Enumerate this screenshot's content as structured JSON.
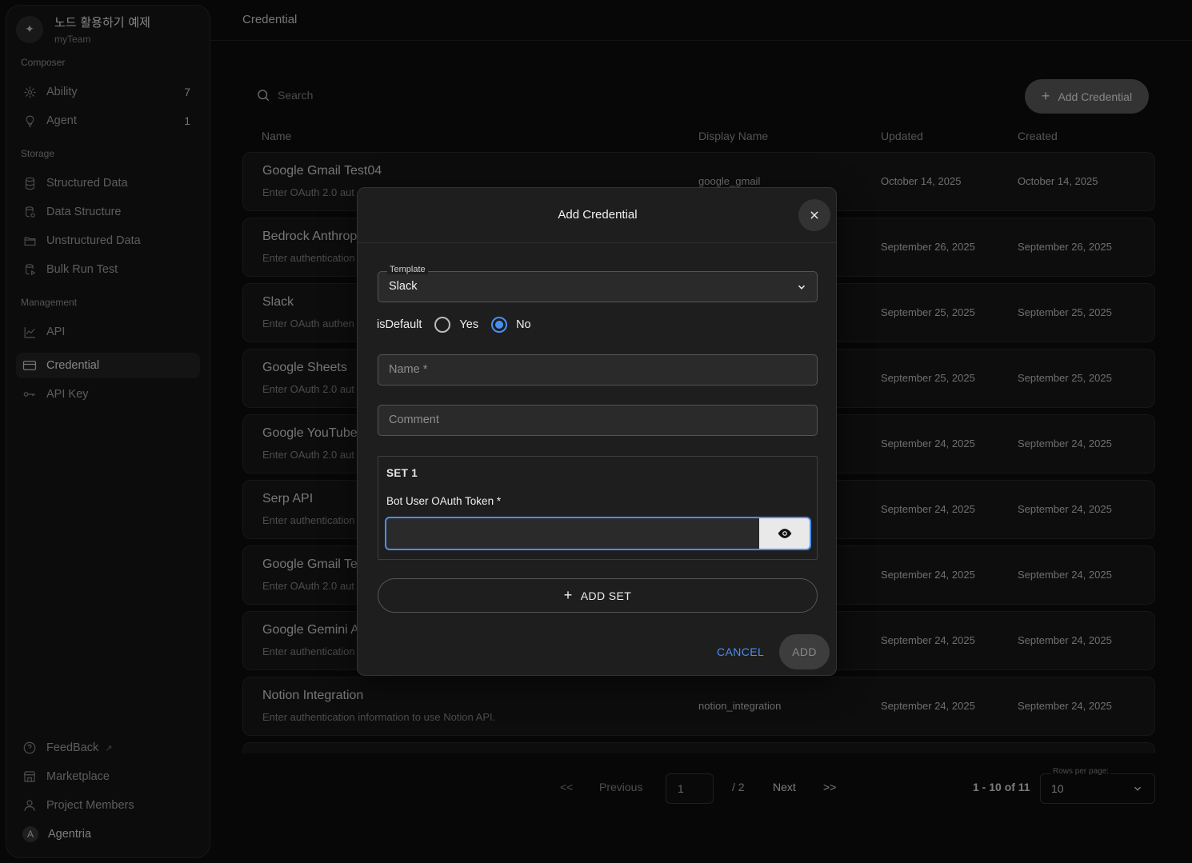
{
  "workspace": {
    "name": "노드 활용하기 예제",
    "team": "myTeam"
  },
  "sidebar": {
    "composer_label": "Composer",
    "storage_label": "Storage",
    "management_label": "Management",
    "items": [
      {
        "label": "Ability",
        "count": "7",
        "icon": "ability-icon"
      },
      {
        "label": "Agent",
        "count": "1",
        "icon": "agent-icon"
      },
      {
        "label": "Structured Data",
        "icon": "database-icon"
      },
      {
        "label": "Data Structure",
        "icon": "data-structure-icon"
      },
      {
        "label": "Unstructured Data",
        "icon": "folder-icon"
      },
      {
        "label": "Bulk Run Test",
        "icon": "bulk-run-icon"
      },
      {
        "label": "API",
        "icon": "chart-line-icon"
      },
      {
        "label": "Credential",
        "icon": "credential-card-icon",
        "active": true
      },
      {
        "label": "API Key",
        "icon": "key-icon"
      }
    ],
    "bottom": [
      {
        "label": "FeedBack",
        "icon": "help-circle-icon"
      },
      {
        "label": "Marketplace",
        "icon": "marketplace-icon"
      },
      {
        "label": "Project Members",
        "icon": "person-icon"
      },
      {
        "label": "Agentria",
        "avatar": "A"
      }
    ]
  },
  "header": {
    "title": "Credential"
  },
  "search": {
    "placeholder": "Search"
  },
  "add_credential_button": "Add Credential",
  "table": {
    "columns": [
      "Name",
      "Display Name",
      "Updated",
      "Created"
    ],
    "rows": [
      {
        "name": "Google Gmail Test04",
        "desc": "Enter OAuth 2.0 aut",
        "display": "google_gmail",
        "updated": "October 14, 2025",
        "created": "October 14, 2025"
      },
      {
        "name": "Bedrock Anthrop",
        "desc": "Enter authentication",
        "display": "",
        "updated": "September 26, 2025",
        "created": "September 26, 2025"
      },
      {
        "name": "Slack",
        "desc": "Enter OAuth authen",
        "display": "",
        "updated": "September 25, 2025",
        "created": "September 25, 2025"
      },
      {
        "name": "Google Sheets",
        "desc": "Enter OAuth 2.0 aut",
        "display": "",
        "updated": "September 25, 2025",
        "created": "September 25, 2025"
      },
      {
        "name": "Google YouTube",
        "desc": "Enter OAuth 2.0 aut",
        "display": "",
        "updated": "September 24, 2025",
        "created": "September 24, 2025"
      },
      {
        "name": "Serp API",
        "desc": "Enter authentication",
        "display": "",
        "updated": "September 24, 2025",
        "created": "September 24, 2025"
      },
      {
        "name": "Google Gmail Te",
        "desc": "Enter OAuth 2.0 aut",
        "display": "",
        "updated": "September 24, 2025",
        "created": "September 24, 2025"
      },
      {
        "name": "Google Gemini A",
        "desc": "Enter authentication",
        "display": "",
        "updated": "September 24, 2025",
        "created": "September 24, 2025"
      },
      {
        "name": "Notion Integration",
        "desc": "Enter authentication information to use Notion API.",
        "display": "notion_integration",
        "updated": "September 24, 2025",
        "created": "September 24, 2025"
      }
    ]
  },
  "pagination": {
    "first": "<<",
    "previous": "Previous",
    "page": "1",
    "total_pages": "/ 2",
    "next": "Next",
    "last": ">>",
    "range": "1 - 10 of 11",
    "rows_per_page_label": "Rows per page:",
    "rows_per_page": "10"
  },
  "modal": {
    "title": "Add Credential",
    "template_label": "Template",
    "template_value": "Slack",
    "is_default_label": "isDefault",
    "yes_label": "Yes",
    "no_label": "No",
    "is_default_selected": "No",
    "name_placeholder": "Name *",
    "comment_placeholder": "Comment",
    "set_title": "SET 1",
    "token_label": "Bot User OAuth Token *",
    "add_set_label": "ADD SET",
    "cancel_label": "CANCEL",
    "add_label": "ADD",
    "accent_color": "#4a8ff0"
  }
}
